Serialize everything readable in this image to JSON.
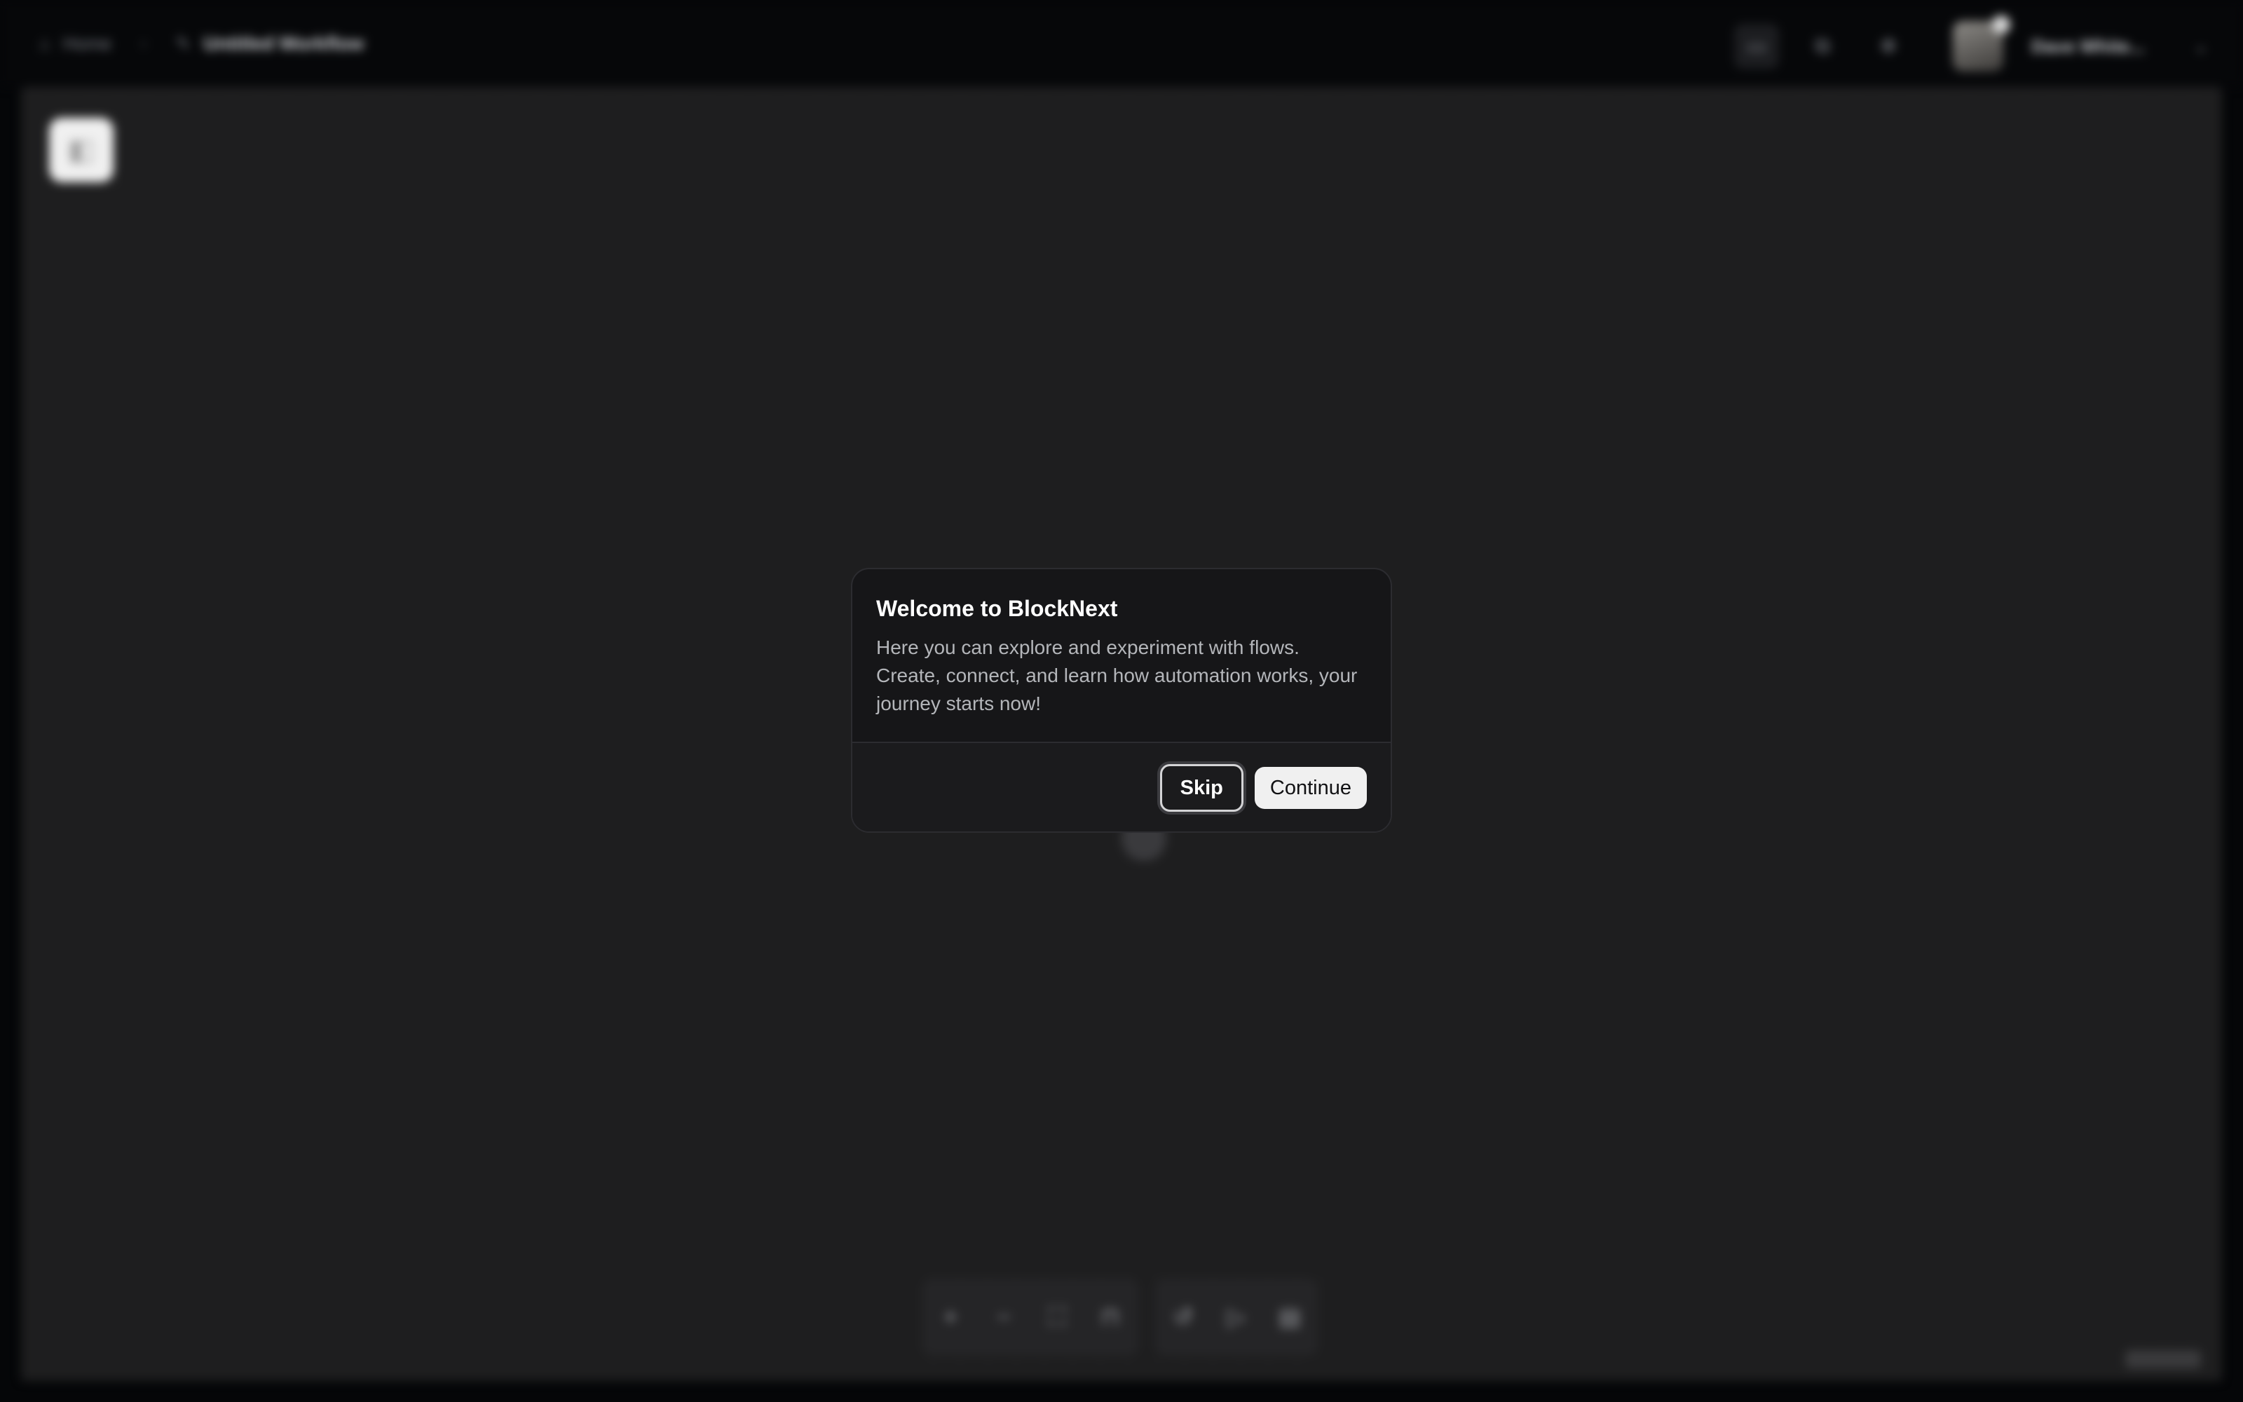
{
  "header": {
    "home_label": "Home",
    "workflow_title": "Untitled Workflow",
    "user_name": "Dave White..."
  },
  "modal": {
    "title": "Welcome to BlockNext",
    "text": "Here you can explore and experiment with flows. Create, connect, and learn how automation works, your journey starts now!",
    "skip_label": "Skip",
    "continue_label": "Continue"
  },
  "colors": {
    "background": "#050608",
    "canvas": "#1e1e1f",
    "modal_bg": "#161618",
    "primary_button": "#f0f0f0"
  }
}
